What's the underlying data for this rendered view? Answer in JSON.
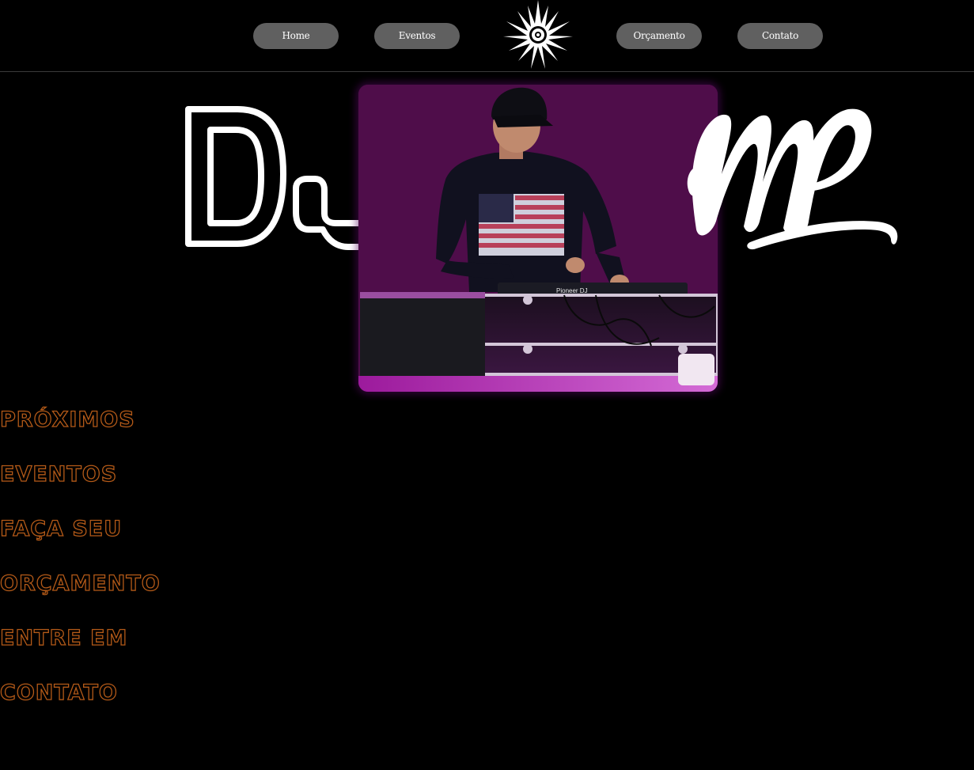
{
  "nav": {
    "items": [
      {
        "label": "Home"
      },
      {
        "label": "Eventos"
      },
      {
        "label": "Orçamento"
      },
      {
        "label": "Contato"
      }
    ],
    "logo_icon": "starburst-icon"
  },
  "hero": {
    "title_left": "DJ",
    "title_right": "MP",
    "photo_subject": "dj-performer-photo",
    "photo_bg_color": "#4f0d4a",
    "mixer_brand": "Pioneer DJ"
  },
  "sections": {
    "links": [
      {
        "line1": "PRÓXIMOS",
        "line2": "EVENTOS"
      },
      {
        "line1": "FAÇA SEU",
        "line2": "ORÇAMENTO"
      },
      {
        "line1": "ENTRE EM",
        "line2": "CONTATO"
      }
    ],
    "outline_color": "#b45a18"
  },
  "colors": {
    "background": "#000000",
    "nav_button": "#606060",
    "nav_text": "#ffffff"
  }
}
